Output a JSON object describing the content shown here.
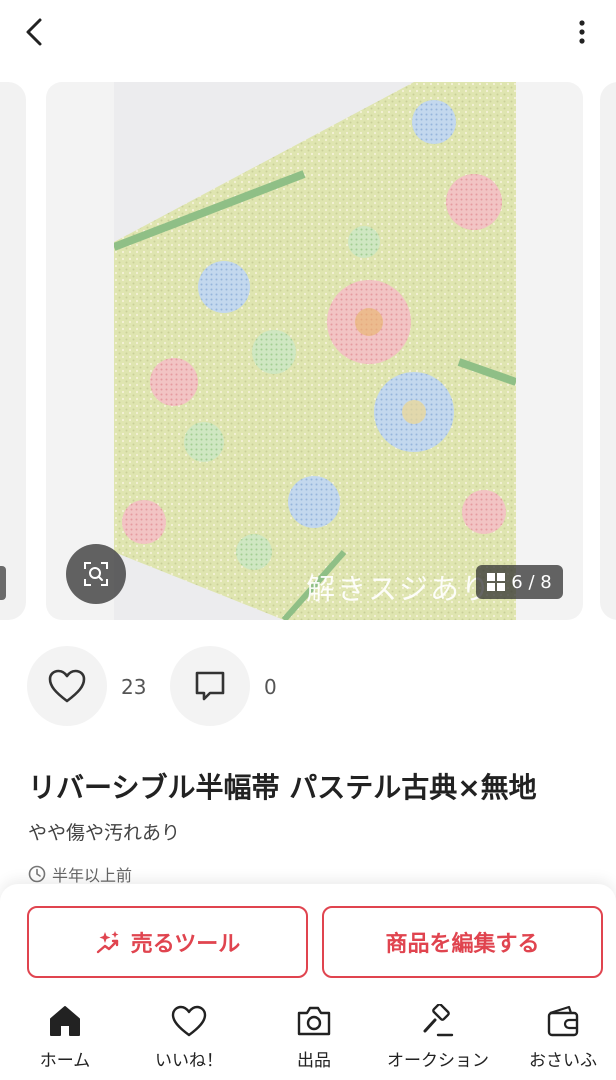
{
  "header": {
    "back_icon": "chevron-left-icon",
    "more_icon": "more-vertical-icon"
  },
  "gallery": {
    "overlay_text": "解きスジあり",
    "counter": "6 / 8",
    "zoom_icon": "image-search-icon"
  },
  "actions": {
    "like_count": "23",
    "comment_count": "0"
  },
  "item": {
    "title": "リバーシブル半幅帯 パステル古典×無地",
    "condition": "やや傷や汚れあり",
    "posted": "半年以上前"
  },
  "buttons": {
    "sell_tool": "売るツール",
    "edit_item": "商品を編集する"
  },
  "tabs": [
    {
      "label": "ホーム",
      "icon": "home-icon"
    },
    {
      "label": "いいね！",
      "icon": "heart-icon"
    },
    {
      "label": "出品",
      "icon": "camera-icon"
    },
    {
      "label": "オークション",
      "icon": "gavel-icon"
    },
    {
      "label": "おさいふ",
      "icon": "wallet-icon"
    }
  ],
  "colors": {
    "accent": "#e0444f",
    "text": "#222222"
  }
}
